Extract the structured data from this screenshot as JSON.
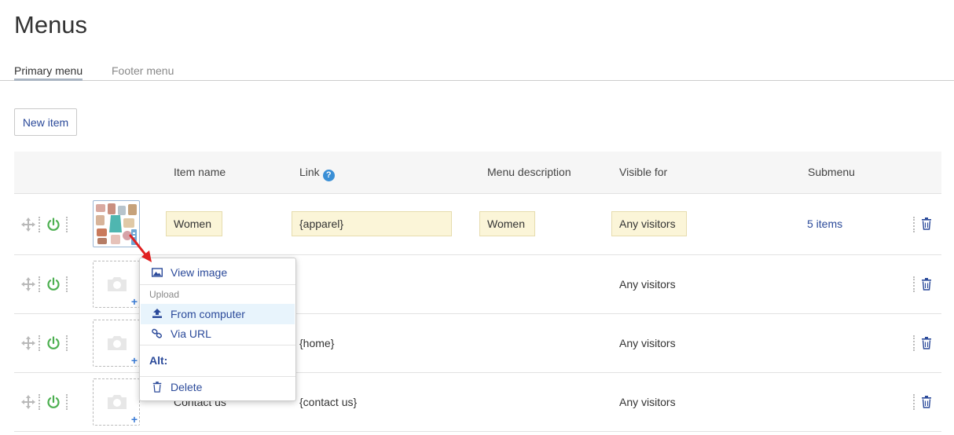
{
  "page": {
    "title": "Menus"
  },
  "tabs": [
    {
      "label": "Primary menu",
      "active": true
    },
    {
      "label": "Footer menu",
      "active": false
    }
  ],
  "toolbar": {
    "new_item_label": "New item"
  },
  "table": {
    "headers": {
      "item_name": "Item name",
      "link": "Link",
      "link_help": "?",
      "menu_description": "Menu description",
      "visible_for": "Visible for",
      "submenu": "Submenu"
    },
    "rows": [
      {
        "item_name": "Women",
        "link": "{apparel}",
        "menu_description": "Women",
        "visible_for": "Any visitors",
        "submenu": "5 items",
        "has_image": true
      },
      {
        "item_name": "",
        "link": "",
        "menu_description": "",
        "visible_for": "Any visitors",
        "submenu": "",
        "has_image": false
      },
      {
        "item_name": "",
        "link": "{home}",
        "menu_description": "",
        "visible_for": "Any visitors",
        "submenu": "",
        "has_image": false
      },
      {
        "item_name": "Contact us",
        "link": "{contact us}",
        "menu_description": "",
        "visible_for": "Any visitors",
        "submenu": "",
        "has_image": false
      }
    ]
  },
  "image_menu": {
    "view_image": "View image",
    "upload_section": "Upload",
    "from_computer": "From computer",
    "via_url": "Via URL",
    "alt_label": "Alt:",
    "delete": "Delete"
  },
  "colors": {
    "accent_blue": "#2b4a9a",
    "power_green": "#4caf50",
    "input_bg": "#fbf5d8",
    "highlight_bg": "#e8f4fc",
    "arrow_red": "#e02020"
  }
}
